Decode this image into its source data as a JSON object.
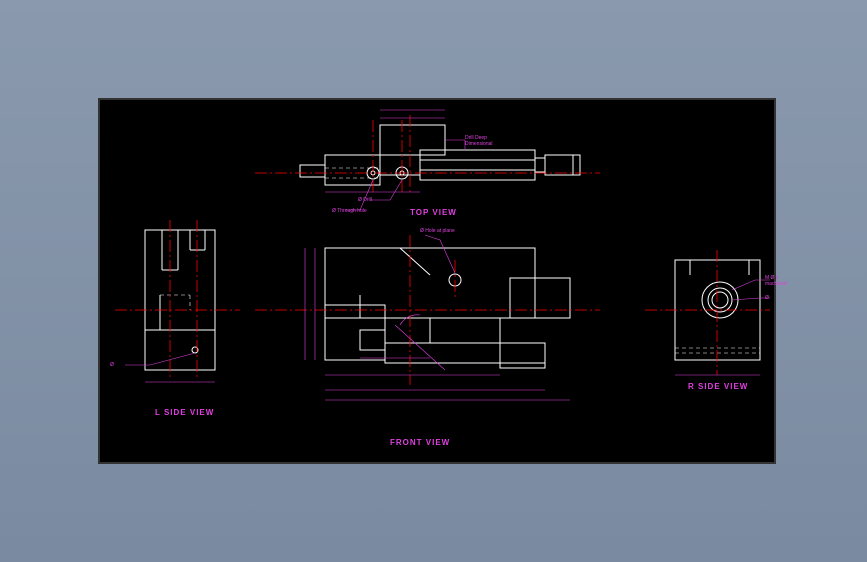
{
  "views": {
    "top": {
      "label": "TOP VIEW"
    },
    "front": {
      "label": "FRONT VIEW"
    },
    "left": {
      "label": "L SIDE VIEW"
    },
    "right": {
      "label": "R SIDE VIEW"
    }
  },
  "annotations": {
    "top_drill_deep": "Drill Deep\nDimensional",
    "top_through_hole": "Ø Through hole",
    "top_drill": "Ø Drill",
    "front_hole_plane": "Ø Hole at plane",
    "right_m_thread": "M Ø x\nmachined",
    "right_diameter": "Ø"
  },
  "dimensions": {
    "left_bottom": "",
    "left_callout": "Ø",
    "top_horiz": "",
    "front_bottom": "",
    "front_width": "",
    "right_bottom": ""
  }
}
